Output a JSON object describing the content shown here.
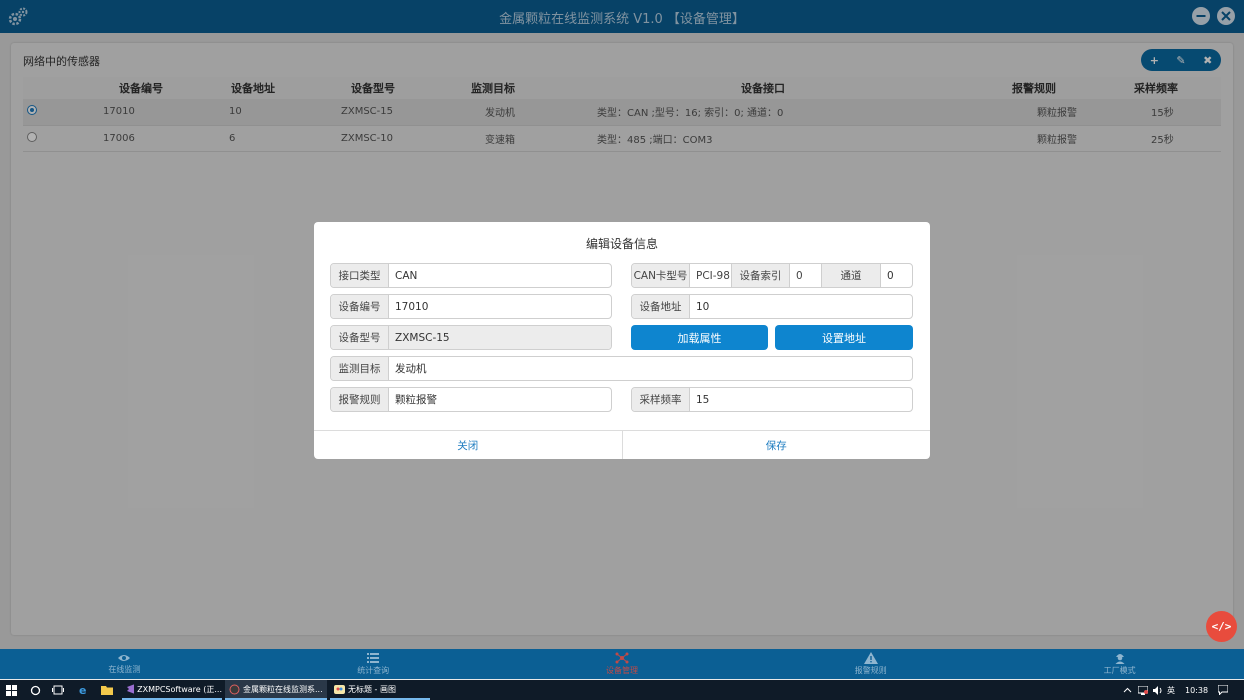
{
  "window": {
    "title": "金属颗粒在线监测系统 V1.0 【设备管理】"
  },
  "panel": {
    "title": "网络中的传感器",
    "toolbar": {
      "add": "+",
      "edit": "✎",
      "delete": "✖"
    }
  },
  "table": {
    "headers": [
      "设备编号",
      "设备地址",
      "设备型号",
      "监测目标",
      "设备接口",
      "报警规则",
      "采样频率"
    ],
    "rows": [
      {
        "selected": true,
        "id": "17010",
        "addr": "10",
        "model": "ZXMSC-15",
        "target": "发动机",
        "iface": "类型：CAN ;型号：16; 索引：0; 通道：0",
        "rule": "颗粒报警",
        "freq": "15秒"
      },
      {
        "selected": false,
        "id": "17006",
        "addr": "6",
        "model": "ZXMSC-10",
        "target": "变速箱",
        "iface": "类型：485 ;端口：COM3",
        "rule": "颗粒报警",
        "freq": "25秒"
      }
    ]
  },
  "dialog": {
    "title": "编辑设备信息",
    "iface_type_label": "接口类型",
    "iface_type_value": "CAN",
    "can_model_label": "CAN卡型号",
    "can_model_value": "PCI-98",
    "dev_index_label": "设备索引",
    "dev_index_value": "0",
    "channel_label": "通道",
    "channel_value": "0",
    "dev_id_label": "设备编号",
    "dev_id_value": "17010",
    "dev_addr_label": "设备地址",
    "dev_addr_value": "10",
    "dev_model_label": "设备型号",
    "dev_model_value": "ZXMSC-15",
    "load_btn": "加载属性",
    "set_addr_btn": "设置地址",
    "target_label": "监测目标",
    "target_value": "发动机",
    "rule_label": "报警规则",
    "rule_value": "颗粒报警",
    "freq_label": "采样频率",
    "freq_value": "15",
    "close_btn": "关闭",
    "save_btn": "保存"
  },
  "fab": {
    "label": "</>"
  },
  "bottom_nav": [
    {
      "label": "在线监测",
      "icon": "eye-icon"
    },
    {
      "label": "统计查询",
      "icon": "list-icon"
    },
    {
      "label": "设备管理",
      "icon": "network-icon"
    },
    {
      "label": "报警规则",
      "icon": "warning-icon"
    },
    {
      "label": "工厂模式",
      "icon": "worker-icon"
    }
  ],
  "taskbar": {
    "apps": [
      "ZXMPCSoftware (正...",
      "金属颗粒在线监测系...",
      "无标题 - 画图"
    ],
    "ime": "英",
    "time": "10:38"
  },
  "colors": {
    "titlebar": "#0b5f94",
    "accent": "#0e85cf",
    "active_nav": "#c24a47",
    "fab": "#e84c3d"
  }
}
